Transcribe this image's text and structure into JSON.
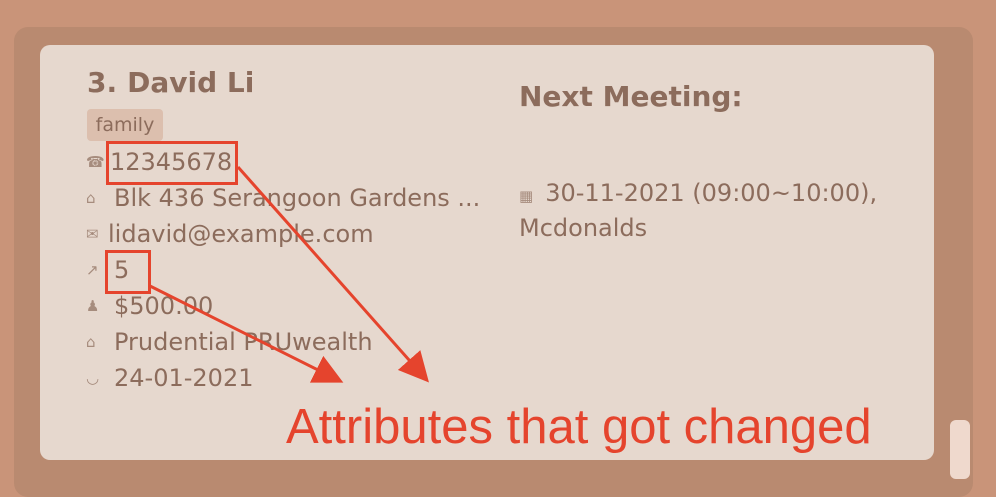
{
  "person": {
    "index": "3.",
    "name": "David Li",
    "tag": "family",
    "phone": "12345678",
    "address": "Blk 436 Serangoon Gardens ...",
    "email": "lidavid@example.com",
    "score": "5",
    "income": "$500.00",
    "policy": "Prudential PRUwealth",
    "date": "24-01-2021"
  },
  "icons": {
    "phone": "telephone-icon",
    "address": "house-icon",
    "email": "envelope-icon",
    "score": "chart-icon",
    "income": "money-bag-icon",
    "policy": "bank-icon",
    "date": "handshake-icon",
    "meeting": "calendar-icon"
  },
  "meeting": {
    "title": "Next Meeting:",
    "datetime": "30-11-2021 (09:00~10:00),",
    "location": "Mcdonalds"
  },
  "annotation": {
    "text": "Attributes that got changed",
    "color": "#e5442d"
  },
  "colors": {
    "background": "#c99479",
    "panel": "#b98a70",
    "card": "#e6d8ce",
    "text": "#8c6c5c",
    "tag": "#dcbfae"
  }
}
